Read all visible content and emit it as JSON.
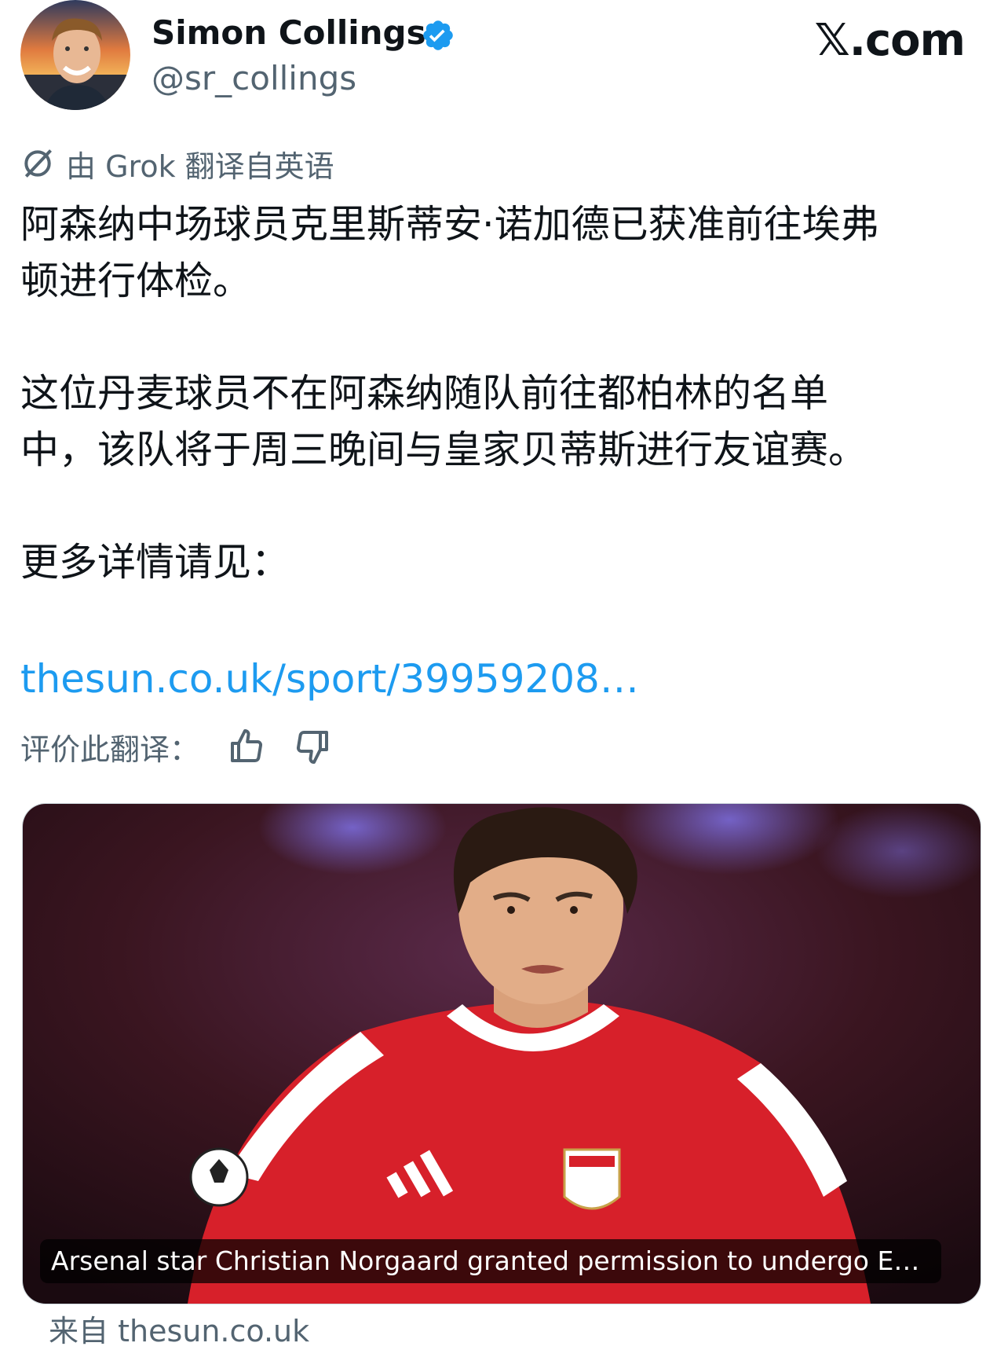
{
  "header": {
    "display_name": "Simon Collings",
    "handle": "@sr_collings",
    "site_watermark": "𝕏.com"
  },
  "translation_note": "由 Grok 翻译自英语",
  "tweet": {
    "paragraph_1": "阿森纳中场球员克里斯蒂安·诺加德已获准前往埃弗\n顿进行体检。",
    "paragraph_2": "这位丹麦球员不在阿森纳随队前往都柏林的名单\n中，该队将于周三晚间与皇家贝蒂斯进行友谊赛。",
    "paragraph_3": "更多详情请见：",
    "link": "thesun.co.uk/sport/39959208…"
  },
  "rating": {
    "label": "评价此翻译："
  },
  "link_card": {
    "headline": "Arsenal star Christian Norgaard granted permission to undergo Ev…",
    "source": "来自 thesun.co.uk"
  },
  "colors": {
    "link_blue": "#1d9bf0",
    "secondary_text": "#536471",
    "verified_blue": "#1d9bf0",
    "arsenal_red": "#d7202a"
  }
}
